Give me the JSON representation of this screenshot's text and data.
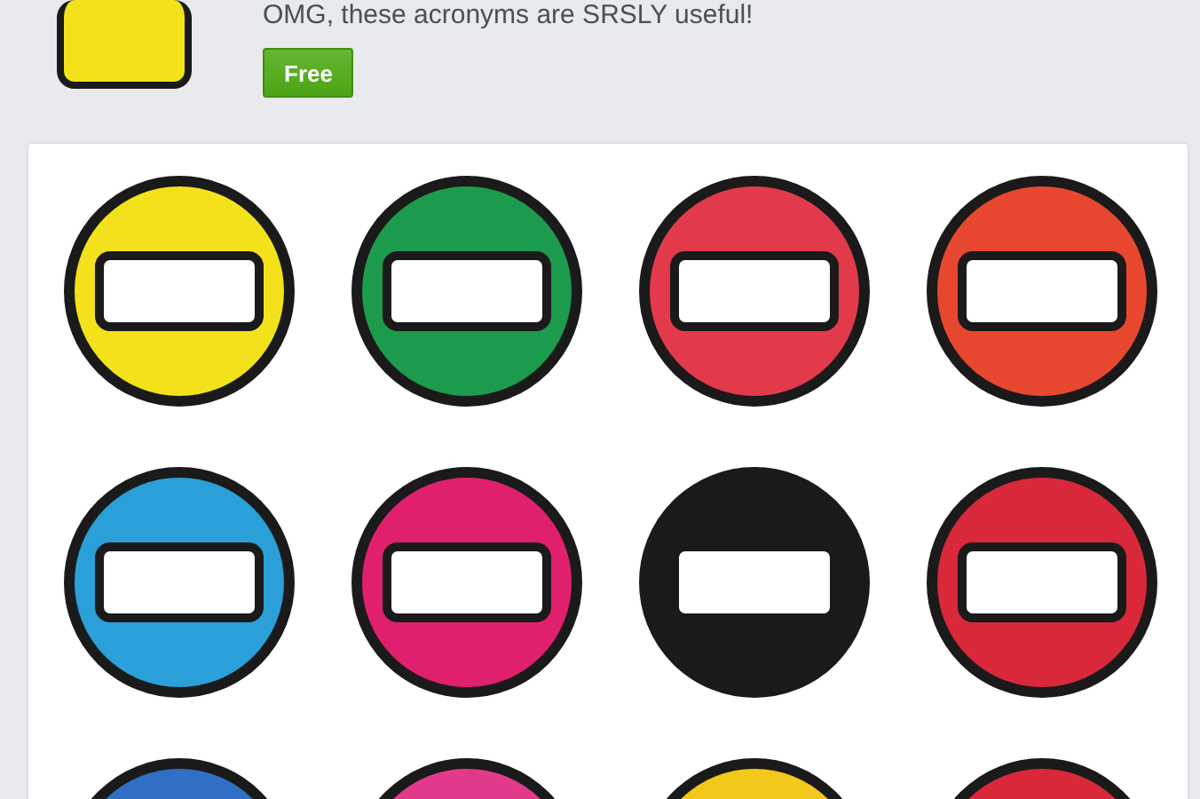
{
  "header": {
    "description": "OMG, these acronyms are SRSLY useful!",
    "button": {
      "label": "Free"
    }
  }
}
